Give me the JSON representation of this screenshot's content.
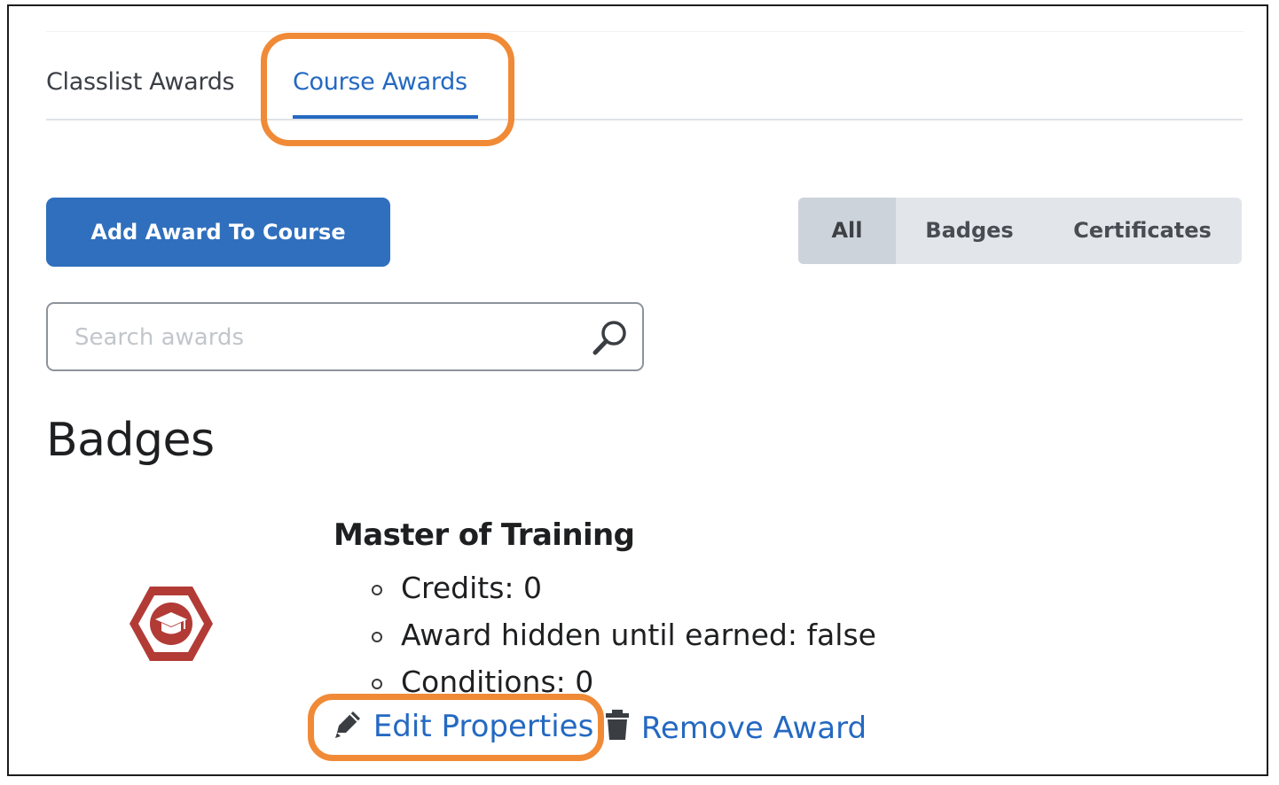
{
  "tabs": [
    {
      "label": "Classlist Awards",
      "active": false
    },
    {
      "label": "Course Awards",
      "active": true
    }
  ],
  "toolbar": {
    "add_button_label": "Add Award To Course"
  },
  "filters": [
    {
      "label": "All",
      "selected": true
    },
    {
      "label": "Badges",
      "selected": false
    },
    {
      "label": "Certificates",
      "selected": false
    }
  ],
  "search": {
    "placeholder": "Search awards",
    "value": ""
  },
  "section": {
    "title": "Badges"
  },
  "award": {
    "name": "Master of Training",
    "icon": "graduation-cap-hexagon-icon",
    "properties": [
      "Credits: 0",
      "Award hidden until earned: false",
      "Conditions: 0"
    ],
    "actions": {
      "edit_label": "Edit Properties",
      "remove_label": "Remove Award"
    }
  },
  "colors": {
    "accent": "#2469c2",
    "button": "#2f6fbd",
    "highlight": "#f08a36",
    "badge": "#b23b36"
  }
}
